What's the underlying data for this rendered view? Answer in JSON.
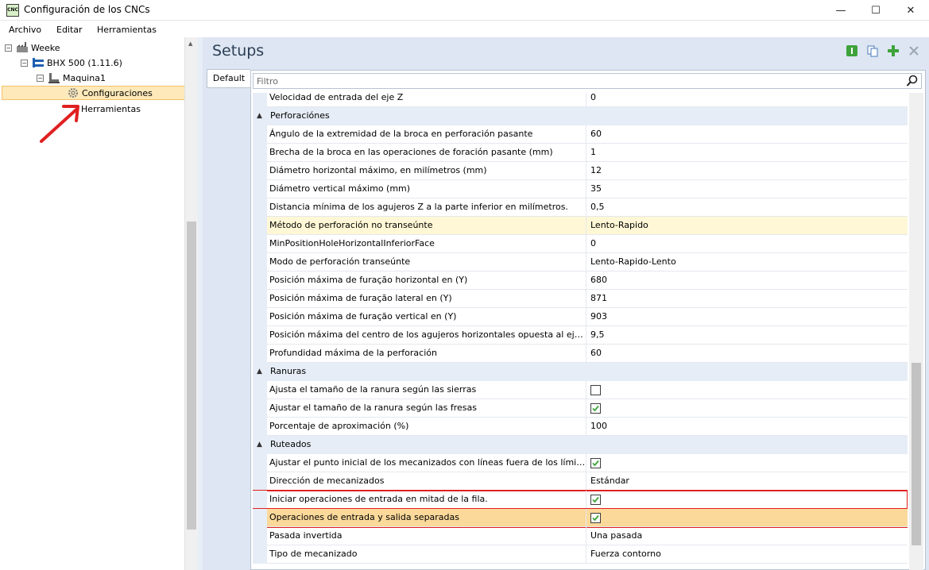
{
  "window": {
    "title": "Configuración de los CNCs",
    "app_icon_text": "CNC",
    "minimize": "—",
    "maximize": "☐",
    "close": "✕"
  },
  "menu": {
    "items": [
      "Archivo",
      "Editar",
      "Herramientas"
    ]
  },
  "tree": {
    "nodes": [
      {
        "label": "Weeke",
        "expander": "−"
      },
      {
        "label": "BHX 500 (1.11.6)",
        "expander": "−"
      },
      {
        "label": "Maquina1",
        "expander": "−"
      },
      {
        "label": "Configuraciones"
      },
      {
        "label": "Herramientas"
      }
    ]
  },
  "main": {
    "title": "Setups",
    "tab": "Default",
    "filter_placeholder": "Filtro"
  },
  "grid": {
    "rows": [
      {
        "type": "prop",
        "name": "Velocidad de entrada del eje Z",
        "value": "0"
      },
      {
        "type": "cat",
        "name": "Perforaciónes"
      },
      {
        "type": "prop",
        "name": "Ángulo de la extremidad de la broca en perforación pasante",
        "value": "60"
      },
      {
        "type": "prop",
        "name": "Brecha de la broca en las operaciones de foración pasante (mm)",
        "value": "1"
      },
      {
        "type": "prop",
        "name": "Diámetro horizontal máximo, en milímetros (mm)",
        "value": "12"
      },
      {
        "type": "prop",
        "name": "Diámetro vertical máximo (mm)",
        "value": "35"
      },
      {
        "type": "prop",
        "name": "Distancia mínima de los agujeros Z a la parte inferior en milímetros.",
        "value": "0,5"
      },
      {
        "type": "prop",
        "name": "Método de perforación no transeúnte",
        "value": "Lento-Rapido",
        "highlight": "yellow"
      },
      {
        "type": "prop",
        "name": "MinPositionHoleHorizontalInferiorFace",
        "value": "0"
      },
      {
        "type": "prop",
        "name": "Modo de perforación transeúnte",
        "value": "Lento-Rapido-Lento"
      },
      {
        "type": "prop",
        "name": "Posición máxima de furação horizontal en (Y)",
        "value": "680"
      },
      {
        "type": "prop",
        "name": "Posición máxima de furação lateral en (Y)",
        "value": "871"
      },
      {
        "type": "prop",
        "name": "Posición máxima de furação vertical en (Y)",
        "value": "903"
      },
      {
        "type": "prop",
        "name": "Posición máxima del centro de los agujeros horizontales opuesta al eje Y de la...",
        "value": "9,5"
      },
      {
        "type": "prop",
        "name": "Profundidad máxima de la perforación",
        "value": "60"
      },
      {
        "type": "cat",
        "name": "Ranuras"
      },
      {
        "type": "check",
        "name": "Ajusta el tamaño de la ranura según las sierras",
        "checked": false
      },
      {
        "type": "check",
        "name": "Ajustar el tamaño de la ranura según las fresas",
        "checked": true
      },
      {
        "type": "prop",
        "name": "Porcentaje de aproximación (%)",
        "value": "100"
      },
      {
        "type": "cat",
        "name": "Ruteados"
      },
      {
        "type": "check",
        "name": "Ajustar el punto inicial de los mecanizados con líneas fuera de los límites de la...",
        "checked": true
      },
      {
        "type": "prop",
        "name": "Dirección de mecanizados",
        "value": "Estándar"
      },
      {
        "type": "check",
        "name": "Iniciar operaciones de entrada en mitad de la fila.",
        "checked": true,
        "boxed": true
      },
      {
        "type": "check",
        "name": "Operaciones de entrada y salida separadas",
        "checked": true,
        "boxed": true,
        "highlight": "orange"
      },
      {
        "type": "prop",
        "name": "Pasada invertida",
        "value": "Una pasada"
      },
      {
        "type": "prop",
        "name": "Tipo de mecanizado",
        "value": "Fuerza contorno"
      }
    ]
  },
  "colors": {
    "accent_green": "#3ea33a",
    "highlight_yellow": "#fff7d6",
    "highlight_orange": "#fbd99a",
    "annotation_red": "#e02020"
  }
}
